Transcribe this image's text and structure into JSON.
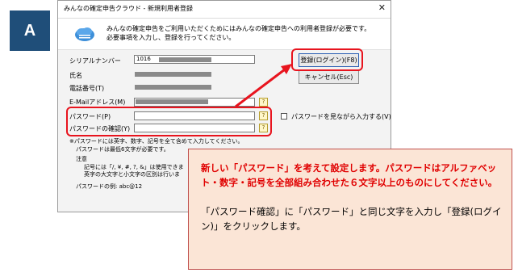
{
  "badge": "A",
  "dialog": {
    "title": "みんなの確定申告クラウド - 新規利用者登録",
    "close_glyph": "✕",
    "header_line1": "みんなの確定申告をご利用いただくためにはみんなの確定申告への利用者登録が必要です。",
    "header_line2": "必要事項を入力し、登録を行ってください。",
    "serial_label": "シリアルナンバー",
    "serial_value": "1016",
    "name_label": "氏名",
    "phone_label": "電話番号(T)",
    "email_label": "E-Mailアドレス(M)",
    "password_label": "パスワード(P)",
    "password_confirm_label": "パスワードの確認(Y)",
    "show_password_label": "パスワードを見ながら入力する(V)",
    "register_button": "登録(ログイン)(F8)",
    "cancel_button": "キャンセル(Esc)",
    "help_glyph": "?",
    "note1": "※パスワードには英字、数字、記号を全て含めて入力してください。",
    "note2": "パスワードは最低6文字が必要です。",
    "note_heading": "注意",
    "note3": "記号には「/, ¥, #, ?, &」は使用できま",
    "note4": "英字の大文字と小文字の区別は行いま",
    "example": "パスワードの例: abc@12"
  },
  "callout": {
    "red_text": "新しい「パスワード」を考えて設定します。パスワードはアルファベット・数字・記号を全部組み合わせた６文字以上のものにしてください。",
    "black_text": "「パスワード確認」に「パスワード」と同じ文字を入力し「登録(ログイン)」をクリックします。"
  },
  "colors": {
    "highlight_red": "#e8141e",
    "callout_bg": "#fbe5d6",
    "badge_bg": "#1f4e79"
  }
}
